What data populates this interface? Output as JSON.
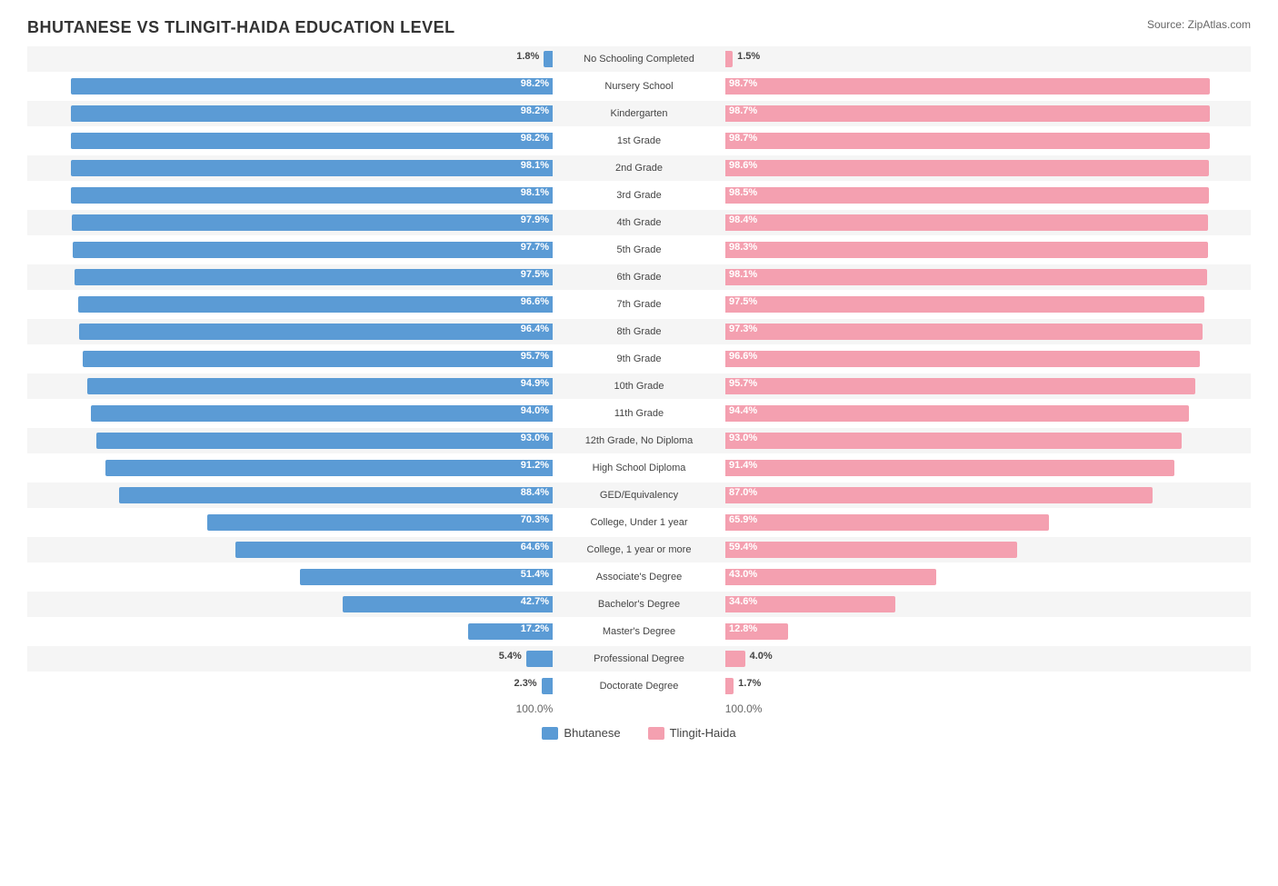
{
  "title": "BHUTANESE VS TLINGIT-HAIDA EDUCATION LEVEL",
  "source": "Source: ZipAtlas.com",
  "colors": {
    "blue": "#5b9bd5",
    "pink": "#f4a0b0",
    "label_bg_blue": "#5b9bd5",
    "label_bg_pink": "#f4a0b0"
  },
  "legend": {
    "left_label": "Bhutanese",
    "right_label": "Tlingit-Haida"
  },
  "axis": {
    "left": "100.0%",
    "right": "100.0%"
  },
  "rows": [
    {
      "label": "No Schooling Completed",
      "left_pct": 1.8,
      "right_pct": 1.5,
      "left_val": "1.8%",
      "right_val": "1.5%"
    },
    {
      "label": "Nursery School",
      "left_pct": 98.2,
      "right_pct": 98.7,
      "left_val": "98.2%",
      "right_val": "98.7%"
    },
    {
      "label": "Kindergarten",
      "left_pct": 98.2,
      "right_pct": 98.7,
      "left_val": "98.2%",
      "right_val": "98.7%"
    },
    {
      "label": "1st Grade",
      "left_pct": 98.2,
      "right_pct": 98.7,
      "left_val": "98.2%",
      "right_val": "98.7%"
    },
    {
      "label": "2nd Grade",
      "left_pct": 98.1,
      "right_pct": 98.6,
      "left_val": "98.1%",
      "right_val": "98.6%"
    },
    {
      "label": "3rd Grade",
      "left_pct": 98.1,
      "right_pct": 98.5,
      "left_val": "98.1%",
      "right_val": "98.5%"
    },
    {
      "label": "4th Grade",
      "left_pct": 97.9,
      "right_pct": 98.4,
      "left_val": "97.9%",
      "right_val": "98.4%"
    },
    {
      "label": "5th Grade",
      "left_pct": 97.7,
      "right_pct": 98.3,
      "left_val": "97.7%",
      "right_val": "98.3%"
    },
    {
      "label": "6th Grade",
      "left_pct": 97.5,
      "right_pct": 98.1,
      "left_val": "97.5%",
      "right_val": "98.1%"
    },
    {
      "label": "7th Grade",
      "left_pct": 96.6,
      "right_pct": 97.5,
      "left_val": "96.6%",
      "right_val": "97.5%"
    },
    {
      "label": "8th Grade",
      "left_pct": 96.4,
      "right_pct": 97.3,
      "left_val": "96.4%",
      "right_val": "97.3%"
    },
    {
      "label": "9th Grade",
      "left_pct": 95.7,
      "right_pct": 96.6,
      "left_val": "95.7%",
      "right_val": "96.6%"
    },
    {
      "label": "10th Grade",
      "left_pct": 94.9,
      "right_pct": 95.7,
      "left_val": "94.9%",
      "right_val": "95.7%"
    },
    {
      "label": "11th Grade",
      "left_pct": 94.0,
      "right_pct": 94.4,
      "left_val": "94.0%",
      "right_val": "94.4%"
    },
    {
      "label": "12th Grade, No Diploma",
      "left_pct": 93.0,
      "right_pct": 93.0,
      "left_val": "93.0%",
      "right_val": "93.0%"
    },
    {
      "label": "High School Diploma",
      "left_pct": 91.2,
      "right_pct": 91.4,
      "left_val": "91.2%",
      "right_val": "91.4%"
    },
    {
      "label": "GED/Equivalency",
      "left_pct": 88.4,
      "right_pct": 87.0,
      "left_val": "88.4%",
      "right_val": "87.0%"
    },
    {
      "label": "College, Under 1 year",
      "left_pct": 70.3,
      "right_pct": 65.9,
      "left_val": "70.3%",
      "right_val": "65.9%"
    },
    {
      "label": "College, 1 year or more",
      "left_pct": 64.6,
      "right_pct": 59.4,
      "left_val": "64.6%",
      "right_val": "59.4%"
    },
    {
      "label": "Associate's Degree",
      "left_pct": 51.4,
      "right_pct": 43.0,
      "left_val": "51.4%",
      "right_val": "43.0%"
    },
    {
      "label": "Bachelor's Degree",
      "left_pct": 42.7,
      "right_pct": 34.6,
      "left_val": "42.7%",
      "right_val": "34.6%"
    },
    {
      "label": "Master's Degree",
      "left_pct": 17.2,
      "right_pct": 12.8,
      "left_val": "17.2%",
      "right_val": "12.8%"
    },
    {
      "label": "Professional Degree",
      "left_pct": 5.4,
      "right_pct": 4.0,
      "left_val": "5.4%",
      "right_val": "4.0%"
    },
    {
      "label": "Doctorate Degree",
      "left_pct": 2.3,
      "right_pct": 1.7,
      "left_val": "2.3%",
      "right_val": "1.7%"
    }
  ]
}
